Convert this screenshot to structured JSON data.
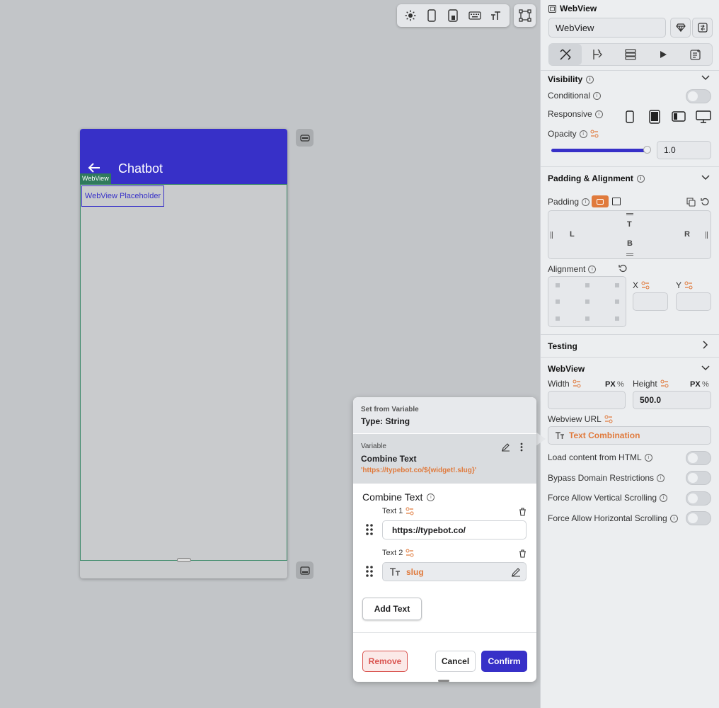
{
  "phone": {
    "title": "Chatbot",
    "webview_tag": "WebView",
    "placeholder": "WebView Placeholder"
  },
  "panel": {
    "header": "WebView",
    "name_value": "WebView",
    "visibility": "Visibility",
    "conditional": "Conditional",
    "responsive": "Responsive",
    "opacity": "Opacity",
    "opacity_value": "1.0",
    "opacity_level": 0.97,
    "padding_alignment": "Padding & Alignment",
    "padding": "Padding",
    "pad_t": "T",
    "pad_b": "B",
    "pad_l": "L",
    "pad_r": "R",
    "alignment": "Alignment",
    "align_x": "X",
    "align_y": "Y",
    "testing": "Testing",
    "webview_section": "WebView",
    "width": "Width",
    "height": "Height",
    "px": "PX",
    "pct": "%",
    "height_value": "500.0",
    "webview_url": "Webview URL",
    "url_value": "Text Combination",
    "load_html": "Load content from HTML",
    "bypass": "Bypass Domain Restrictions",
    "force_v": "Force Allow Vertical Scrolling",
    "force_h": "Force Allow Horizontal Scrolling"
  },
  "popup": {
    "set_from": "Set from Variable",
    "type": "Type: String",
    "variable_label": "Variable",
    "variable_name": "Combine Text",
    "variable_expr": "'https://typebot.co/${widget!.slug}'",
    "section_title": "Combine Text",
    "text1_label": "Text 1",
    "text1_value": "https://typebot.co/",
    "text2_label": "Text 2",
    "text2_value": "slug",
    "add_text": "Add Text",
    "remove": "Remove",
    "cancel": "Cancel",
    "confirm": "Confirm"
  },
  "colors": {
    "accent": "#3730c8",
    "orange": "#e07a3c",
    "danger": "#d9534f"
  }
}
